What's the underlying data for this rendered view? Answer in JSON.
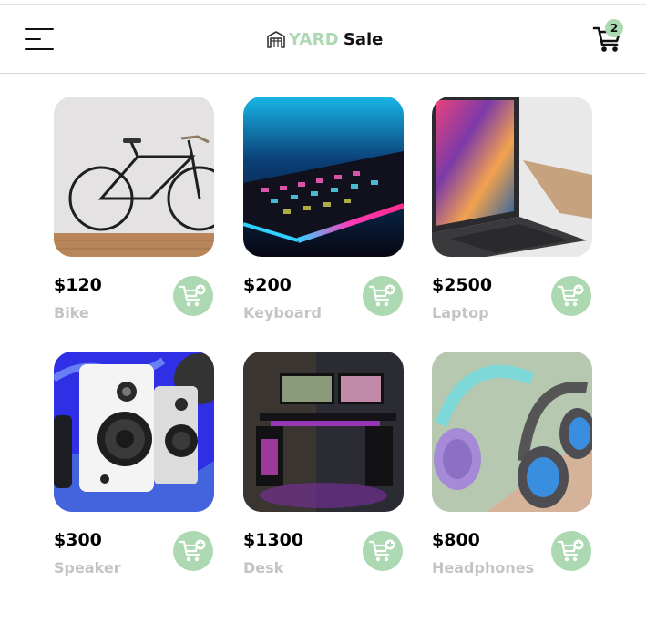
{
  "header": {
    "logo_yard": "YARD",
    "logo_sale": "Sale",
    "cart_count": "2"
  },
  "colors": {
    "accent": "#acd9b2",
    "muted_text": "#c4c4c4"
  },
  "products": [
    {
      "price": "$120",
      "name": "Bike",
      "image": "bike-photo"
    },
    {
      "price": "$200",
      "name": "Keyboard",
      "image": "keyboard-photo"
    },
    {
      "price": "$2500",
      "name": "Laptop",
      "image": "laptop-photo"
    },
    {
      "price": "$300",
      "name": "Speaker",
      "image": "speaker-photo"
    },
    {
      "price": "$1300",
      "name": "Desk",
      "image": "desk-photo"
    },
    {
      "price": "$800",
      "name": "Headphones",
      "image": "headphones-photo"
    }
  ],
  "icons": [
    "menu-icon",
    "store-icon",
    "shopping-cart-icon",
    "add-to-cart-icon"
  ]
}
